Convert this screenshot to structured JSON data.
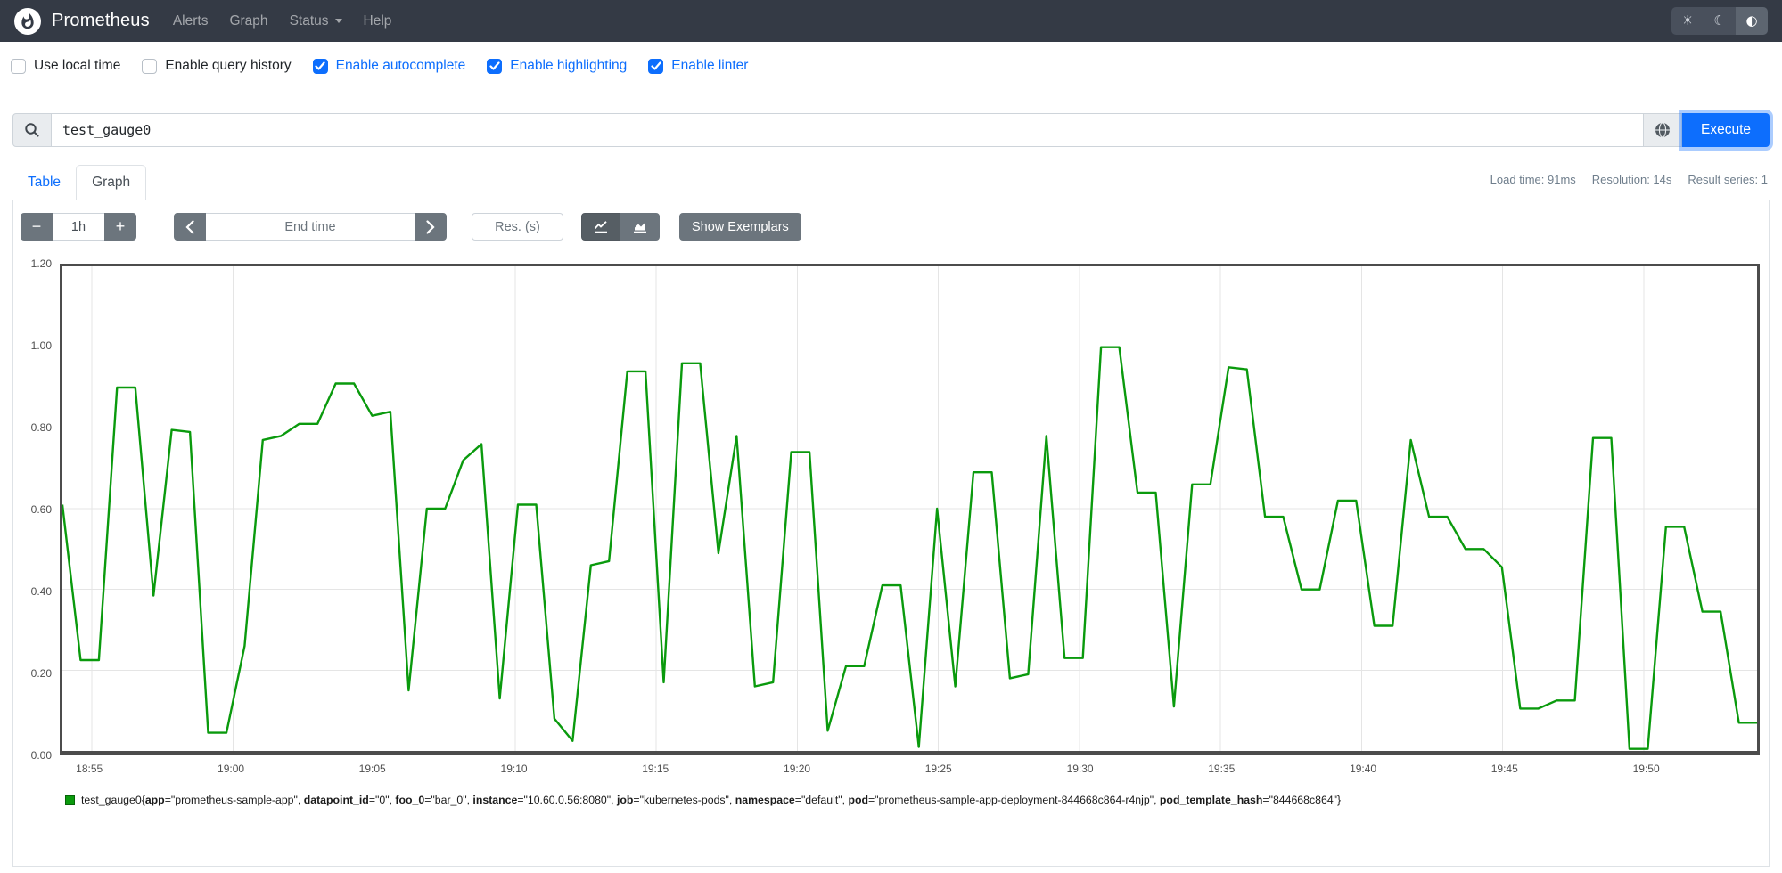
{
  "navbar": {
    "brand": "Prometheus",
    "links": [
      {
        "label": "Alerts"
      },
      {
        "label": "Graph"
      },
      {
        "label": "Status",
        "dropdown": true
      },
      {
        "label": "Help"
      }
    ]
  },
  "theme_toggle": {
    "options": [
      {
        "name": "light",
        "glyph": "☀"
      },
      {
        "name": "dark",
        "glyph": "☾"
      },
      {
        "name": "auto",
        "glyph": "◐"
      }
    ],
    "active": "auto"
  },
  "settings": {
    "checkboxes": [
      {
        "label": "Use local time",
        "checked": false
      },
      {
        "label": "Enable query history",
        "checked": false
      },
      {
        "label": "Enable autocomplete",
        "checked": true
      },
      {
        "label": "Enable highlighting",
        "checked": true
      },
      {
        "label": "Enable linter",
        "checked": true
      }
    ]
  },
  "query": {
    "value": "test_gauge0",
    "execute_label": "Execute"
  },
  "stats": {
    "load_time": "Load time: 91ms",
    "resolution": "Resolution: 14s",
    "result_series": "Result series: 1"
  },
  "tabs": [
    {
      "label": "Table",
      "active": false
    },
    {
      "label": "Graph",
      "active": true
    }
  ],
  "controls": {
    "minus": "−",
    "plus": "+",
    "range_value": "1h",
    "end_time_placeholder": "End time",
    "res_placeholder": "Res. (s)",
    "show_exemplars": "Show Exemplars"
  },
  "chart_data": {
    "type": "line",
    "title": "",
    "xlabel": "",
    "ylabel": "",
    "ylim": [
      0,
      1.2
    ],
    "grid": true,
    "legend_position": "bottom",
    "y_ticks": [
      "0.00",
      "0.20",
      "0.40",
      "0.60",
      "0.80",
      "1.00",
      "1.20"
    ],
    "x_ticks": [
      {
        "label": "18:55",
        "pos": 0.0174
      },
      {
        "label": "19:00",
        "pos": 0.1007
      },
      {
        "label": "19:05",
        "pos": 0.1839
      },
      {
        "label": "19:10",
        "pos": 0.2672
      },
      {
        "label": "19:15",
        "pos": 0.3504
      },
      {
        "label": "19:20",
        "pos": 0.4337
      },
      {
        "label": "19:25",
        "pos": 0.5169
      },
      {
        "label": "19:30",
        "pos": 0.6002
      },
      {
        "label": "19:35",
        "pos": 0.6834
      },
      {
        "label": "19:40",
        "pos": 0.7667
      },
      {
        "label": "19:45",
        "pos": 0.8499
      },
      {
        "label": "19:50",
        "pos": 0.9332
      }
    ],
    "x_range": {
      "start": "18:54",
      "end": "19:54"
    },
    "series": [
      {
        "name": "test_gauge0",
        "color": "#0a9a0d",
        "values": [
          0.61,
          0.225,
          0.225,
          0.9,
          0.9,
          0.385,
          0.795,
          0.79,
          0.045,
          0.045,
          0.26,
          0.77,
          0.78,
          0.81,
          0.81,
          0.91,
          0.91,
          0.83,
          0.84,
          0.15,
          0.6,
          0.6,
          0.72,
          0.76,
          0.13,
          0.61,
          0.61,
          0.08,
          0.025,
          0.46,
          0.47,
          0.94,
          0.94,
          0.17,
          0.96,
          0.96,
          0.49,
          0.78,
          0.16,
          0.17,
          0.74,
          0.74,
          0.05,
          0.21,
          0.21,
          0.41,
          0.41,
          0.01,
          0.6,
          0.16,
          0.69,
          0.69,
          0.18,
          0.19,
          0.78,
          0.23,
          0.23,
          1.0,
          1.0,
          0.64,
          0.64,
          0.11,
          0.66,
          0.66,
          0.95,
          0.945,
          0.58,
          0.58,
          0.4,
          0.4,
          0.62,
          0.62,
          0.31,
          0.31,
          0.77,
          0.58,
          0.58,
          0.5,
          0.5,
          0.455,
          0.105,
          0.105,
          0.125,
          0.125,
          0.775,
          0.775,
          0.005,
          0.005,
          0.555,
          0.555,
          0.345,
          0.345,
          0.07,
          0.07
        ]
      }
    ]
  },
  "legend": {
    "metric": "test_gauge0",
    "labels": [
      [
        "app",
        "prometheus-sample-app"
      ],
      [
        "datapoint_id",
        "0"
      ],
      [
        "foo_0",
        "bar_0"
      ],
      [
        "instance",
        "10.60.0.56:8080"
      ],
      [
        "job",
        "kubernetes-pods"
      ],
      [
        "namespace",
        "default"
      ],
      [
        "pod",
        "prometheus-sample-app-deployment-844668c864-r4njp"
      ],
      [
        "pod_template_hash",
        "844668c864"
      ]
    ]
  },
  "colors": {
    "accent_blue": "#0d6efd",
    "series_green": "#0a9a0d",
    "navbar_bg": "#343a45",
    "border_gray": "#dee2e6",
    "button_gray": "#6c757d"
  }
}
